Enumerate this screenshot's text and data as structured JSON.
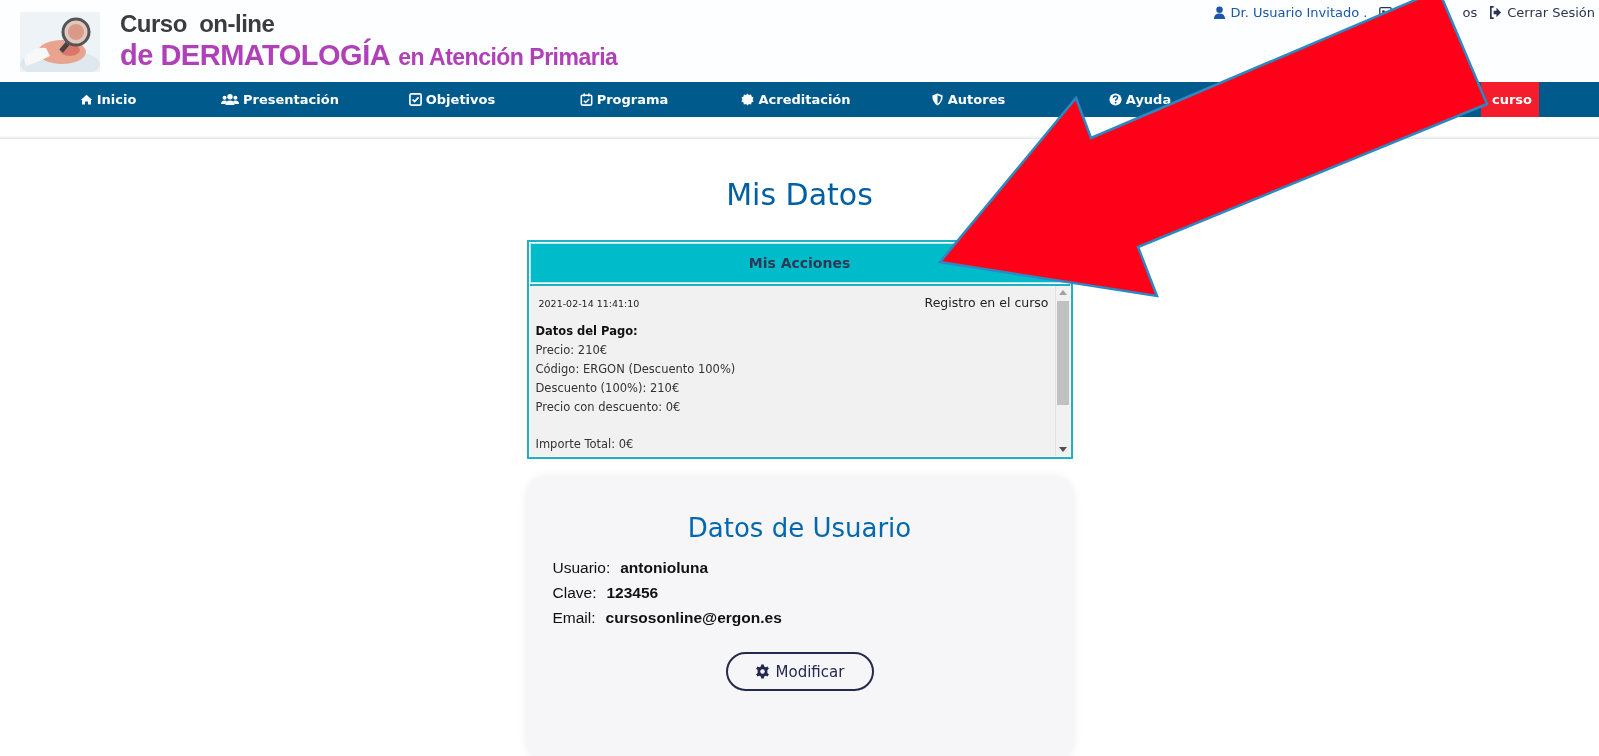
{
  "header": {
    "logo": {
      "line_1": "Curso  on-line",
      "line_2_main": "de DERMATOLOGÍA",
      "line_2_rest": "en Atención Primaria"
    },
    "user_menu": [
      {
        "kind": "user",
        "label": "Dr. Usuario Invitado ."
      },
      {
        "kind": "card",
        "label": "os"
      },
      {
        "kind": "logout",
        "label": "Cerrar Sesión"
      }
    ]
  },
  "nav": [
    {
      "kind": "home",
      "label": "Inicio",
      "highlighted": false
    },
    {
      "kind": "users",
      "label": "Presentación",
      "highlighted": false
    },
    {
      "kind": "check",
      "label": "Objetivos",
      "highlighted": false
    },
    {
      "kind": "calendar",
      "label": "Programa",
      "highlighted": false
    },
    {
      "kind": "badge",
      "label": "Acreditación",
      "highlighted": false
    },
    {
      "kind": "shield",
      "label": "Autores",
      "highlighted": false
    },
    {
      "kind": "help",
      "label": "Ayuda",
      "highlighted": false
    },
    {
      "kind": "plain",
      "label": "curso",
      "highlighted": true
    }
  ],
  "page_title": "Mis Datos",
  "actions": {
    "title": "Mis Acciones",
    "entries": [
      {
        "date": "2021-02-14 11:41:10",
        "action": "Registro en el curso",
        "details_title": "Datos del Pago:",
        "details": [
          "Precio: 210€",
          "Código: ERGON (Descuento 100%)",
          "Descuento (100%): 210€",
          "Precio con descuento: 0€"
        ],
        "total": "Importe Total: 0€"
      }
    ]
  },
  "user_data": {
    "title": "Datos de Usuario",
    "fields": [
      {
        "label": "Usuario:",
        "value": "antonioluna"
      },
      {
        "label": "Clave:",
        "value": "123456"
      },
      {
        "label": "Email:",
        "value": "cursosonline@ergon.es"
      }
    ],
    "button": "Modificar"
  }
}
